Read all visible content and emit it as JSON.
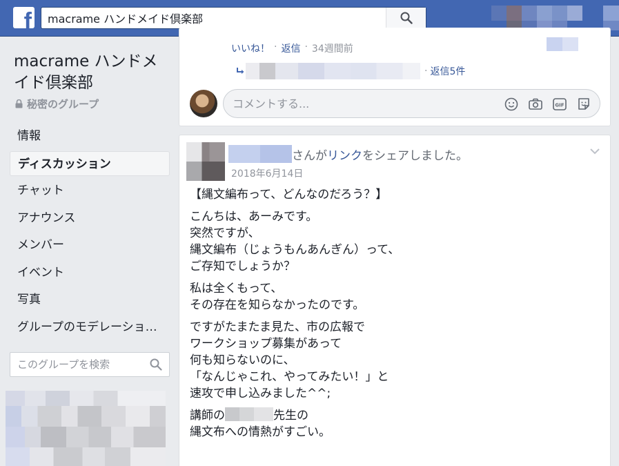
{
  "header": {
    "logo_letter": "f",
    "search_value": "macrame ハンドメイド倶楽部"
  },
  "sidebar": {
    "group_name": "macrame ハンドメイド倶楽部",
    "privacy": "秘密のグループ",
    "items": [
      {
        "label": "情報",
        "active": false
      },
      {
        "label": "ディスカッション",
        "active": true
      },
      {
        "label": "チャット",
        "active": false
      },
      {
        "label": "アナウンス",
        "active": false
      },
      {
        "label": "メンバー",
        "active": false
      },
      {
        "label": "イベント",
        "active": false
      },
      {
        "label": "写真",
        "active": false
      },
      {
        "label": "グループのモデレーショ…",
        "active": false
      }
    ],
    "search_placeholder": "このグループを検索"
  },
  "previous_comment": {
    "like": "いいね！",
    "reply": "返信",
    "time": "34週間前",
    "replies_link": "返信5件",
    "separator": "·"
  },
  "comment_box": {
    "placeholder": "コメントする...",
    "icons": [
      "emoji-icon",
      "camera-icon",
      "gif-icon",
      "sticker-icon"
    ]
  },
  "post": {
    "header_suffix": "さんが",
    "header_link": "リンク",
    "header_tail": "をシェアしました。",
    "date": "2018年6月14日",
    "paragraphs": [
      [
        "【縄文編布って、どんなのだろう？】"
      ],
      [
        "こんちは、あーみです。",
        "突然ですが、",
        "縄文編布（じょうもんあんぎん）って、",
        "ご存知でしょうか？"
      ],
      [
        "私は全くもって、",
        "その存在を知らなかったのです。"
      ],
      [
        "ですがたまたま見た、市の広報で",
        "ワークショップ募集があって",
        "何も知らないのに、",
        "「なんじゃこれ、やってみたい！」と",
        "速攻で申し込みました^^;"
      ]
    ],
    "teacher_prefix": "講師の",
    "teacher_suffix": "先生の",
    "teacher_line2": "縄文布への情熱がすごい。"
  },
  "colors": {
    "brand": "#4267b2",
    "link": "#385898",
    "background": "#e9ebee"
  }
}
